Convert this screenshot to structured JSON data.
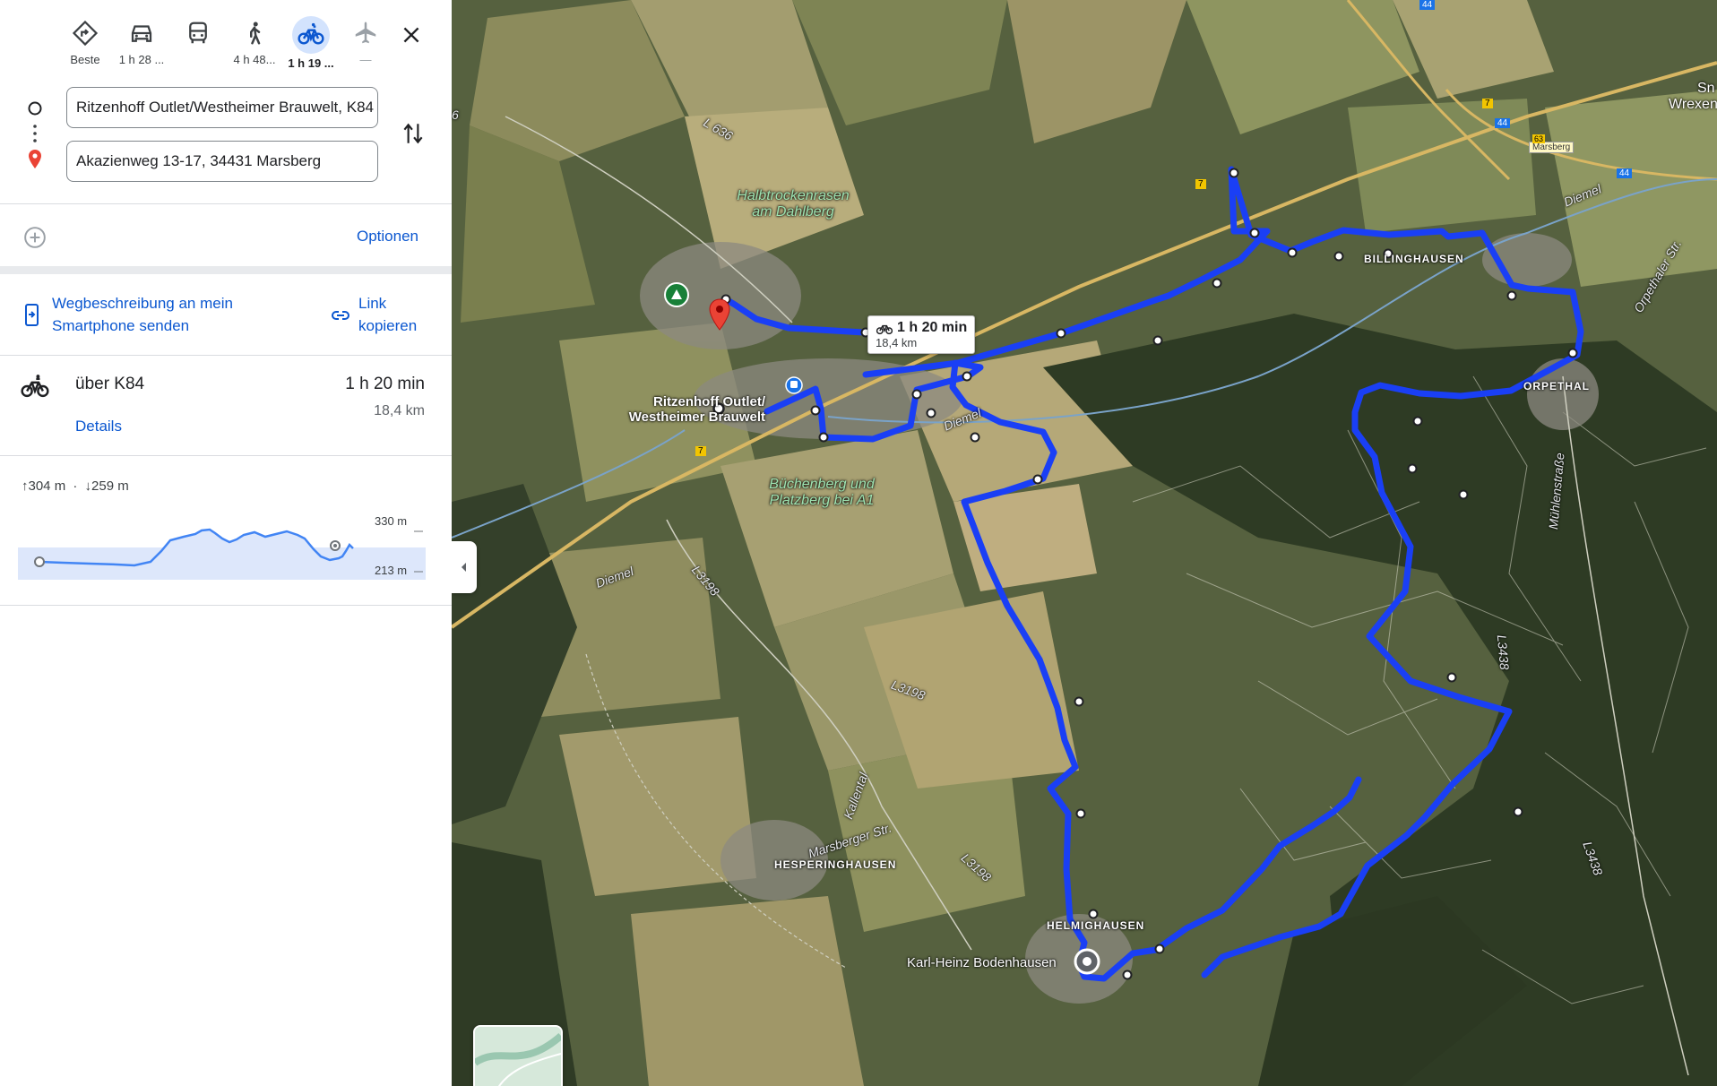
{
  "modes": [
    {
      "name": "best",
      "label": "Beste",
      "icon": "route-icon"
    },
    {
      "name": "car",
      "label": "1 h 28 ...",
      "icon": "car-icon"
    },
    {
      "name": "transit",
      "label": "",
      "icon": "bus-icon"
    },
    {
      "name": "walk",
      "label": "4 h 48...",
      "icon": "walk-icon"
    },
    {
      "name": "bike",
      "label": "1 h 19 ...",
      "icon": "bike-icon"
    },
    {
      "name": "flight",
      "label": "—",
      "icon": "plane-icon"
    }
  ],
  "origin": {
    "value": "Ritzenhoff Outlet/Westheimer Brauwelt, K84"
  },
  "destination": {
    "value": "Akazienweg 13-17, 34431 Marsberg"
  },
  "options_label": "Optionen",
  "share": {
    "send_label": "Wegbeschreibung an mein Smartphone senden",
    "link_label": "Link kopieren"
  },
  "route": {
    "via": "über K84",
    "duration": "1 h 20 min",
    "distance": "18,4 km",
    "details_label": "Details"
  },
  "elevation": {
    "ascent": "304 m",
    "descent": "259 m",
    "max_label": "330 m",
    "min_label": "213 m"
  },
  "map": {
    "callout": {
      "duration": "1 h 20 min",
      "distance": "18,4 km"
    },
    "places": {
      "origin": "Ritzenhoff Outlet/ Westheimer Brauwelt",
      "dest": "Karl-Heinz Bodenhausen",
      "billinghausen": "BILLINGHAUSEN",
      "orpethal": "ORPETHAL",
      "helmighausen": "HELMIGHAUSEN",
      "hesperinghausen": "HESPERINGHAUSEN",
      "halbtrocken": "Halbtrockenrasen am Dahlberg",
      "buchenberg": "Büchenberg und Platzberg bei A1",
      "marsberg": "Marsberg",
      "wrexen": "Wrexen",
      "sn": "Sn"
    },
    "roads": {
      "l636": "L 636",
      "diemel1": "Diemel",
      "diemel2": "Diemel",
      "diemel3": "Diemel",
      "l3198a": "L3198",
      "l3198b": "L3198",
      "l3198c": "L3198",
      "kallental": "Kallental",
      "marsberger": "Marsberger Str.",
      "l3438a": "L3438",
      "l3438b": "L3438",
      "muehlen": "Mühlenstraße",
      "orpethaler": "Orpethaler Str.",
      "a44a": "44",
      "a44b": "44",
      "a44c": "44",
      "r7a": "7",
      "r7b": "7",
      "r7c": "7",
      "exit63": "63",
      "l6": "6"
    }
  },
  "colors": {
    "route": "#1a3ff5",
    "accent": "#0b57d0",
    "pin": "#ea4335",
    "active_mode_bg": "#d3e3fd"
  }
}
